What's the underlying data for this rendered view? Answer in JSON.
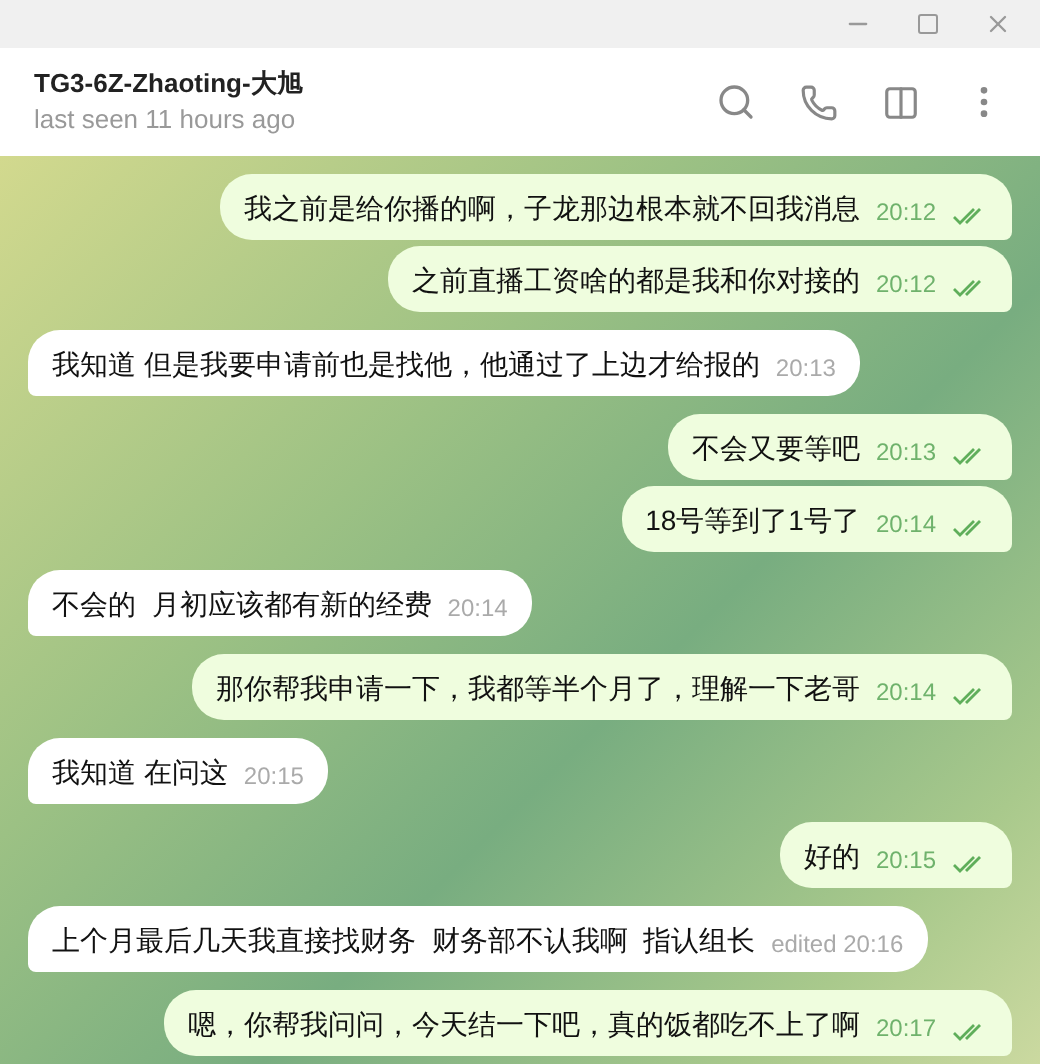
{
  "header": {
    "title": "TG3-6Z-Zhaoting-大旭",
    "status": "last seen 11 hours ago"
  },
  "messages": [
    {
      "kind": "out",
      "text": "我之前是给你播的啊，子龙那边根本就不回我消息",
      "time": "20:12",
      "read": true
    },
    {
      "kind": "out",
      "text": "之前直播工资啥的都是我和你对接的",
      "time": "20:12",
      "read": true
    },
    {
      "kind": "in",
      "text": "我知道 但是我要申请前也是找他，他通过了上边才给报的",
      "time": "20:13"
    },
    {
      "kind": "out",
      "text": "不会又要等吧",
      "time": "20:13",
      "read": true
    },
    {
      "kind": "out",
      "text": "18号等到了1号了",
      "time": "20:14",
      "read": true
    },
    {
      "kind": "in",
      "text": "不会的  月初应该都有新的经费",
      "time": "20:14"
    },
    {
      "kind": "out",
      "text": "那你帮我申请一下，我都等半个月了，理解一下老哥",
      "time": "20:14",
      "read": true
    },
    {
      "kind": "in",
      "text": "我知道 在问这",
      "time": "20:15"
    },
    {
      "kind": "out",
      "text": "好的",
      "time": "20:15",
      "read": true
    },
    {
      "kind": "in",
      "text": "上个月最后几天我直接找财务  财务部不认我啊  指认组长",
      "time": "edited 20:16"
    },
    {
      "kind": "out",
      "text": "嗯，你帮我问问，今天结一下吧，真的饭都吃不上了啊",
      "time": "20:17",
      "read": true
    }
  ]
}
